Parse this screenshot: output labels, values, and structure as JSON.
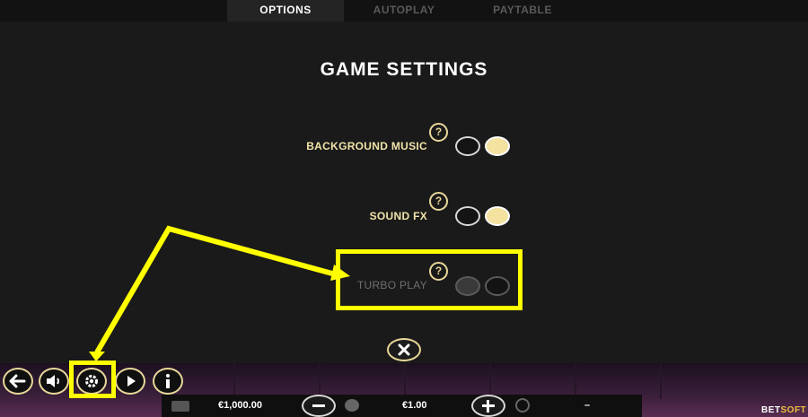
{
  "tabs": [
    {
      "label": "OPTIONS",
      "active": true
    },
    {
      "label": "AUTOPLAY",
      "active": false
    },
    {
      "label": "PAYTABLE",
      "active": false
    }
  ],
  "title": "GAME SETTINGS",
  "help_symbol": "?",
  "settings": [
    {
      "label": "BACKGROUND MUSIC",
      "state": "on",
      "enabled": true
    },
    {
      "label": "SOUND FX",
      "state": "on",
      "enabled": true
    },
    {
      "label": "TURBO PLAY",
      "state": "off",
      "enabled": false
    }
  ],
  "close_icon": "close-x-icon",
  "toolbar": {
    "icons": [
      "back-arrow-icon",
      "speaker-icon",
      "gear-icon",
      "autoplay-icon",
      "info-icon"
    ]
  },
  "status_bar": {
    "balance": "€1,000.00",
    "bet": "€1.00",
    "win": "–"
  },
  "brand": {
    "part1": "BET",
    "part2": "SOFT"
  },
  "colors": {
    "accent_gold": "#e8d79a",
    "toggle_on": "#f4e2a0",
    "highlight": "#ffff00",
    "background": "#1a1a1a"
  }
}
